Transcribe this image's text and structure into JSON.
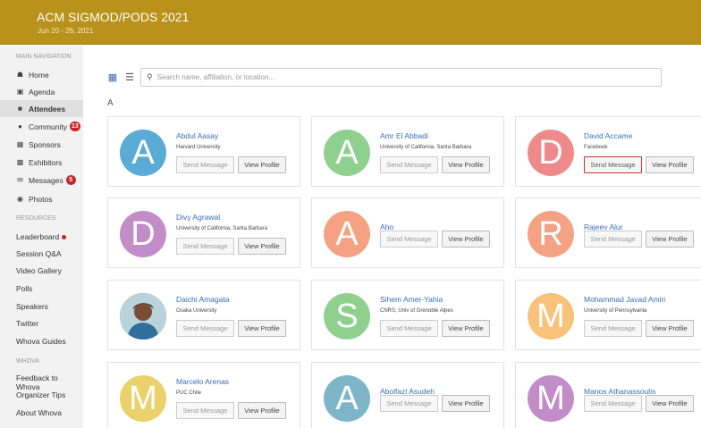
{
  "header": {
    "title": "ACM SIGMOD/PODS 2021",
    "dates": "Jun 20 - 26, 2021"
  },
  "sidebar": {
    "main_heading": "MAIN NAVIGATION",
    "main_items": [
      {
        "label": "Home",
        "icon": "home-icon"
      },
      {
        "label": "Agenda",
        "icon": "calendar-icon"
      },
      {
        "label": "Attendees",
        "icon": "people-icon",
        "active": true
      },
      {
        "label": "Community",
        "icon": "chat-icon",
        "badge": "13"
      },
      {
        "label": "Sponsors",
        "icon": "sponsor-icon"
      },
      {
        "label": "Exhibitors",
        "icon": "building-icon"
      },
      {
        "label": "Messages",
        "icon": "envelope-icon",
        "badge": "5"
      },
      {
        "label": "Photos",
        "icon": "camera-icon"
      }
    ],
    "resources_heading": "RESOURCES",
    "resource_items": [
      "Leaderboard",
      "Session Q&A",
      "Video Gallery",
      "Polls",
      "Speakers",
      "Twitter",
      "Whova Guides"
    ],
    "whova_heading": "WHOVA",
    "whova_items": [
      "Feedback to Whova",
      "Organizer Tips",
      "About Whova"
    ]
  },
  "search": {
    "placeholder": "Search name, affiliation, or location..."
  },
  "section_letter": "A",
  "buttons": {
    "send": "Send Message",
    "view": "View Profile"
  },
  "attendees": [
    {
      "name": "Abdul Aasay",
      "affiliation": "Harvard University",
      "initial": "A",
      "color": "#5aabd6"
    },
    {
      "name": "Amr El Abbadi",
      "affiliation": "University of California, Santa Barbara",
      "initial": "A",
      "color": "#8fd08f"
    },
    {
      "name": "David Accame",
      "affiliation": "Facebook",
      "initial": "D",
      "color": "#ee8a8a"
    },
    {
      "name": "Divy Agrawal",
      "affiliation": "University of California, Santa Barbara",
      "initial": "D",
      "color": "#c18cc8"
    },
    {
      "name": "Aho",
      "affiliation": "",
      "initial": "A",
      "color": "#f4a283"
    },
    {
      "name": "Rajeev Alur",
      "affiliation": "",
      "initial": "R",
      "color": "#f4a283"
    },
    {
      "name": "Daichi Amagata",
      "affiliation": "Osaka University",
      "initial": "",
      "color": "#2a5a6e"
    },
    {
      "name": "Sihem Amer-Yahia",
      "affiliation": "CNRS, Univ of Grenoble Alpes",
      "initial": "S",
      "color": "#8fd08f"
    },
    {
      "name": "Mohammad Javad Amiri",
      "affiliation": "University of Pennsylvania",
      "initial": "M",
      "color": "#f8c27a"
    },
    {
      "name": "Marcelo Arenas",
      "affiliation": "PUC Chile",
      "initial": "M",
      "color": "#ead16a"
    },
    {
      "name": "Abolfazl Asudeh",
      "affiliation": "",
      "initial": "A",
      "color": "#7fb5c8"
    },
    {
      "name": "Manos Athanassoulis",
      "affiliation": "",
      "initial": "M",
      "color": "#c18cc8"
    }
  ]
}
